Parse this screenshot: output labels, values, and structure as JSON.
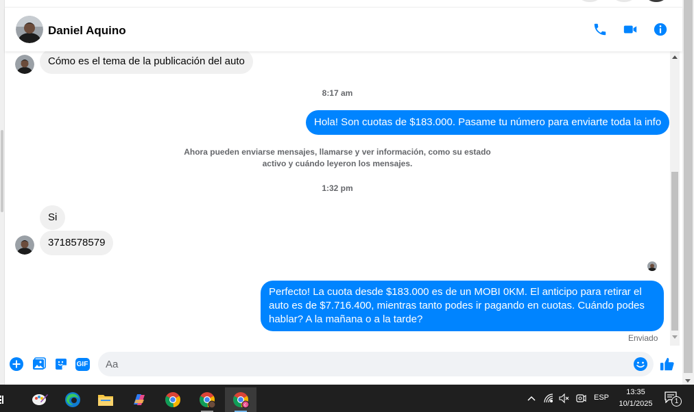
{
  "contact": {
    "name": "Daniel Aquino",
    "avatar": "avatar-icon"
  },
  "header_actions": {
    "call": "phone-icon",
    "video": "video-camera-icon",
    "info": "info-icon"
  },
  "messages": {
    "m1": "Cómo es el tema de la publicación del auto",
    "t1": "8:17 am",
    "m2": "Hola! Son cuotas de $183.000. Pasame tu número para enviarte toda la info",
    "notice_line1": "Ahora pueden enviarse mensajes, llamarse y ver información, como su estado",
    "notice_line2": "activo y cuándo leyeron los mensajes.",
    "t2": "1:32 pm",
    "m3": "Si",
    "m4": "3718578579",
    "m5": "Perfecto! La cuota desde $183.000 es de un MOBI 0KM. El anticipo para retirar el auto es de $7.716.400, mientras tanto podes ir pagando en cuotas. Cuándo podes hablar? A la mañana o a la tarde?",
    "status": "Enviado"
  },
  "composer": {
    "placeholder": "Aa",
    "gif_label": "GIF",
    "icons": [
      "plus-circle-icon",
      "image-icon",
      "sticker-icon",
      "gif-icon",
      "emoji-icon",
      "thumbs-up-icon"
    ]
  },
  "taskbar": {
    "apps": [
      "task-view-icon",
      "paint-icon",
      "edge-icon",
      "file-explorer-icon",
      "copilot-icon",
      "chrome-icon",
      "chrome-profile-icon",
      "chrome-profile-c-icon"
    ],
    "language": "ESP",
    "time": "13:35",
    "date": "10/1/2025",
    "notification_count": "1"
  },
  "colors": {
    "accent": "#0084ff",
    "incoming_bubble": "#f0f0f0",
    "taskbar": "#1f1f1f"
  }
}
